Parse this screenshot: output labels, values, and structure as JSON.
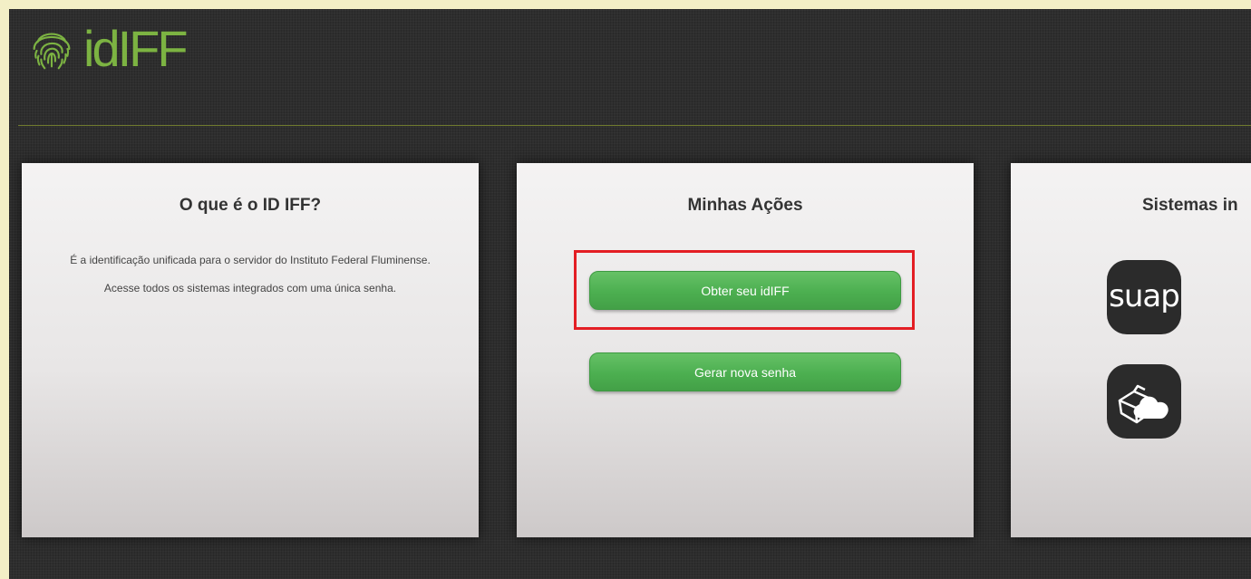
{
  "brand": {
    "logo_text": "idIFF",
    "accent_color": "#7cb342",
    "dot_color": "#e31e24"
  },
  "cards": {
    "about": {
      "title": "O que é o ID IFF?",
      "paragraph_1": "É a identificação unificada para o servidor do Instituto Federal Fluminense.",
      "paragraph_2": "Acesse todos os sistemas integrados com uma única senha."
    },
    "actions": {
      "title": "Minhas Ações",
      "obter_label": "Obter seu idIFF",
      "gerar_label": "Gerar nova senha",
      "highlight_color": "#e31e24",
      "button_color": "#4caf50"
    },
    "systems": {
      "title": "Sistemas in",
      "items": [
        {
          "label": "suap",
          "icon": "suap-logo-icon"
        },
        {
          "label": "",
          "icon": "cloud-storage-icon"
        }
      ]
    }
  }
}
